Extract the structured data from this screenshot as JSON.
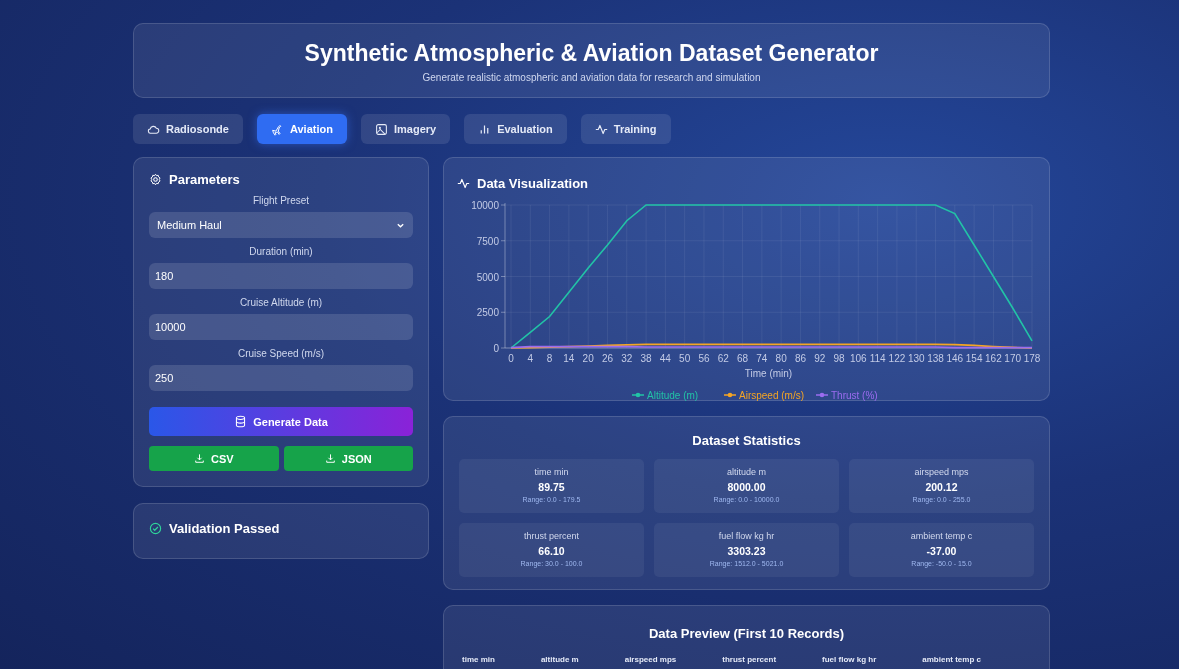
{
  "header": {
    "title": "Synthetic Atmospheric & Aviation Dataset Generator",
    "subtitle": "Generate realistic atmospheric and aviation data for research and simulation"
  },
  "tabs": [
    {
      "label": "Radiosonde",
      "kind": "cloud",
      "selected": false
    },
    {
      "label": "Aviation",
      "kind": "plane",
      "selected": true
    },
    {
      "label": "Imagery",
      "kind": "image",
      "selected": false
    },
    {
      "label": "Evaluation",
      "kind": "bars",
      "selected": false
    },
    {
      "label": "Training",
      "kind": "pulse",
      "selected": false
    }
  ],
  "parameters": {
    "title": "Parameters",
    "fields": [
      {
        "kind": "select",
        "label": "Flight Preset",
        "value": "Medium Haul"
      },
      {
        "kind": "input",
        "label": "Duration (min)",
        "value": "180"
      },
      {
        "kind": "input",
        "label": "Cruise Altitude (m)",
        "value": "10000"
      },
      {
        "kind": "input",
        "label": "Cruise Speed (m/s)",
        "value": "250"
      }
    ],
    "generate_button": "Generate Data",
    "download_buttons": [
      "CSV",
      "JSON"
    ]
  },
  "validation": {
    "title": "Validation Passed"
  },
  "visualization": {
    "title": "Data Visualization",
    "chart_data": {
      "type": "line",
      "xlabel": "Time (min)",
      "grid": true,
      "legend": true,
      "categories": [
        "0",
        "4",
        "8",
        "14",
        "20",
        "26",
        "32",
        "38",
        "44",
        "50",
        "56",
        "62",
        "68",
        "74",
        "80",
        "86",
        "92",
        "98",
        "106",
        "114",
        "122",
        "130",
        "138",
        "146",
        "154",
        "162",
        "170",
        "178"
      ],
      "ylim": [
        0,
        10000
      ],
      "yticks": [
        0,
        2500,
        5000,
        7500,
        10000
      ],
      "series": [
        {
          "name": "Altitude (m)",
          "color": "#22c3a6",
          "values": [
            0,
            1100,
            2200,
            3900,
            5600,
            7200,
            8900,
            10000,
            10000,
            10000,
            10000,
            10000,
            10000,
            10000,
            10000,
            10000,
            10000,
            10000,
            10000,
            10000,
            10000,
            10000,
            10000,
            9400,
            7200,
            5000,
            2800,
            500
          ]
        },
        {
          "name": "Airspeed (m/s)",
          "color": "#f5a524",
          "values": [
            0,
            30,
            60,
            100,
            140,
            180,
            220,
            250,
            250,
            250,
            250,
            250,
            250,
            250,
            250,
            250,
            250,
            250,
            250,
            250,
            250,
            250,
            250,
            240,
            180,
            100,
            40,
            0
          ]
        },
        {
          "name": "Thrust (%)",
          "color": "#9b6cf0",
          "values": [
            30,
            100,
            100,
            100,
            100,
            100,
            100,
            70,
            70,
            70,
            70,
            70,
            70,
            70,
            70,
            70,
            70,
            70,
            70,
            70,
            70,
            70,
            70,
            30,
            30,
            30,
            30,
            30
          ]
        }
      ]
    }
  },
  "statistics": {
    "title": "Dataset Statistics",
    "items": [
      {
        "label": "time min",
        "value": "89.75",
        "range": "Range: 0.0 - 179.5"
      },
      {
        "label": "altitude m",
        "value": "8000.00",
        "range": "Range: 0.0 - 10000.0"
      },
      {
        "label": "airspeed mps",
        "value": "200.12",
        "range": "Range: 0.0 - 255.0"
      },
      {
        "label": "thrust percent",
        "value": "66.10",
        "range": "Range: 30.0 - 100.0"
      },
      {
        "label": "fuel flow kg hr",
        "value": "3303.23",
        "range": "Range: 1512.0 - 5021.0"
      },
      {
        "label": "ambient temp c",
        "value": "-37.00",
        "range": "Range: -50.0 - 15.0"
      }
    ]
  },
  "preview": {
    "title": "Data Preview (First 10 Records)",
    "columns": [
      "time min",
      "altitude m",
      "airspeed mps",
      "thrust percent",
      "fuel flow kg hr",
      "ambient temp c"
    ]
  }
}
